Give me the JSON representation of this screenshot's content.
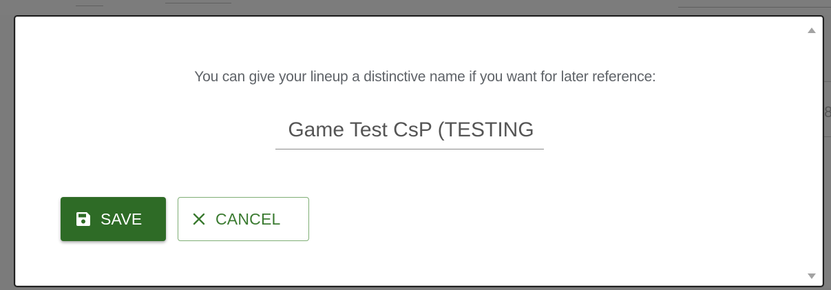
{
  "dialog": {
    "prompt": "You can give your lineup a distinctive name if you want for later reference:",
    "lineup_name_value": "Game Test CsP (TESTING",
    "save_label": "SAVE",
    "cancel_label": "CANCEL"
  },
  "background": {
    "partial_text": "8"
  },
  "icons": {
    "save": "floppy-disk-icon",
    "cancel": "close-x-icon",
    "scroll_up": "scroll-up-arrow-icon",
    "scroll_down": "scroll-down-arrow-icon"
  },
  "colors": {
    "save_button": "#2e6b26",
    "cancel_text": "#3a7a30",
    "cancel_border": "#7fae75",
    "overlay": "#7b7b7b"
  }
}
